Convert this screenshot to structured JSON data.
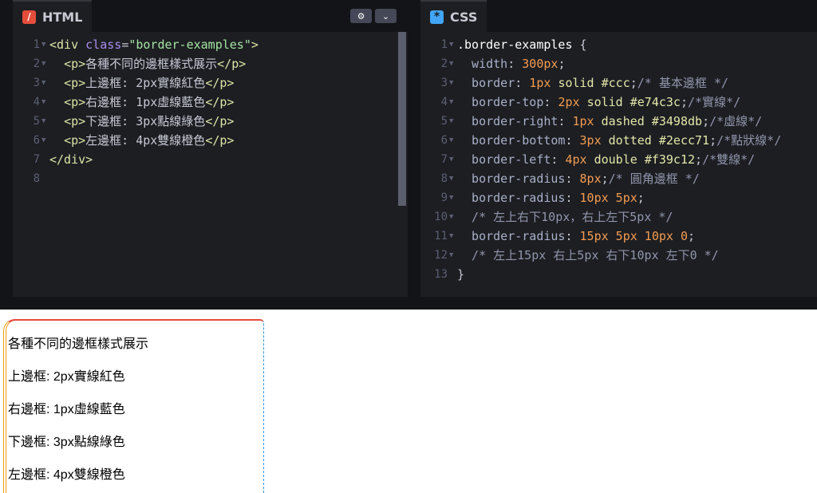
{
  "html_panel": {
    "tab_label": "HTML",
    "tab_icon": "html-logo-icon",
    "buttons": [
      "gear-icon",
      "chevron-down-icon"
    ],
    "lines": [
      {
        "n": "1",
        "fold": true,
        "tokens": [
          [
            "t-tag",
            "<div "
          ],
          [
            "t-attr",
            "class"
          ],
          [
            "t-punc",
            "="
          ],
          [
            "t-str",
            "\"border-examples\""
          ],
          [
            "t-tag",
            ">"
          ]
        ]
      },
      {
        "n": "2",
        "fold": true,
        "tokens": [
          [
            "t-punc",
            "  "
          ],
          [
            "t-tag",
            "<p>"
          ],
          [
            "t-punc",
            "各種不同的邊框樣式展示"
          ],
          [
            "t-tag",
            "</p>"
          ]
        ]
      },
      {
        "n": "3",
        "fold": true,
        "tokens": [
          [
            "t-punc",
            "  "
          ],
          [
            "t-tag",
            "<p>"
          ],
          [
            "t-punc",
            "上邊框: 2px實線紅色"
          ],
          [
            "t-tag",
            "</p>"
          ]
        ]
      },
      {
        "n": "4",
        "fold": true,
        "tokens": [
          [
            "t-punc",
            "  "
          ],
          [
            "t-tag",
            "<p>"
          ],
          [
            "t-punc",
            "右邊框: 1px虛線藍色"
          ],
          [
            "t-tag",
            "</p>"
          ]
        ]
      },
      {
        "n": "5",
        "fold": true,
        "tokens": [
          [
            "t-punc",
            "  "
          ],
          [
            "t-tag",
            "<p>"
          ],
          [
            "t-punc",
            "下邊框: 3px點線綠色"
          ],
          [
            "t-tag",
            "</p>"
          ]
        ]
      },
      {
        "n": "6",
        "fold": true,
        "tokens": [
          [
            "t-punc",
            "  "
          ],
          [
            "t-tag",
            "<p>"
          ],
          [
            "t-punc",
            "左邊框: 4px雙線橙色"
          ],
          [
            "t-tag",
            "</p>"
          ]
        ]
      },
      {
        "n": "7",
        "fold": false,
        "tokens": [
          [
            "t-tag",
            "</div>"
          ]
        ]
      },
      {
        "n": "8",
        "fold": false,
        "tokens": []
      }
    ]
  },
  "css_panel": {
    "tab_label": "CSS",
    "tab_icon": "css-asterisk-icon",
    "lines": [
      {
        "n": "1",
        "fold": true,
        "tokens": [
          [
            "t-sel",
            ".border-examples "
          ],
          [
            "t-punc",
            "{"
          ]
        ]
      },
      {
        "n": "2",
        "fold": true,
        "tokens": [
          [
            "t-prop",
            "  width"
          ],
          [
            "t-punc",
            ": "
          ],
          [
            "t-num",
            "300px"
          ],
          [
            "t-punc",
            ";"
          ]
        ]
      },
      {
        "n": "3",
        "fold": true,
        "tokens": [
          [
            "t-prop",
            "  border"
          ],
          [
            "t-punc",
            ": "
          ],
          [
            "t-num",
            "1px "
          ],
          [
            "t-kw",
            "solid "
          ],
          [
            "t-kw",
            "#ccc"
          ],
          [
            "t-punc",
            ";"
          ],
          [
            "t-cmt",
            "/* 基本邊框 */"
          ]
        ]
      },
      {
        "n": "4",
        "fold": true,
        "tokens": [
          [
            "t-prop",
            "  border-top"
          ],
          [
            "t-punc",
            ": "
          ],
          [
            "t-num",
            "2px "
          ],
          [
            "t-kw",
            "solid "
          ],
          [
            "t-kw",
            "#e74c3c"
          ],
          [
            "t-punc",
            ";"
          ],
          [
            "t-cmt",
            "/*實線*/"
          ]
        ]
      },
      {
        "n": "5",
        "fold": true,
        "tokens": [
          [
            "t-prop",
            "  border-right"
          ],
          [
            "t-punc",
            ": "
          ],
          [
            "t-num",
            "1px "
          ],
          [
            "t-kw",
            "dashed "
          ],
          [
            "t-kw",
            "#3498db"
          ],
          [
            "t-punc",
            ";"
          ],
          [
            "t-cmt",
            "/*虛線*/"
          ]
        ]
      },
      {
        "n": "6",
        "fold": true,
        "tokens": [
          [
            "t-prop",
            "  border-bottom"
          ],
          [
            "t-punc",
            ": "
          ],
          [
            "t-num",
            "3px "
          ],
          [
            "t-kw",
            "dotted "
          ],
          [
            "t-kw",
            "#2ecc71"
          ],
          [
            "t-punc",
            ";"
          ],
          [
            "t-cmt",
            "/*點狀線*/"
          ]
        ]
      },
      {
        "n": "7",
        "fold": true,
        "tokens": [
          [
            "t-prop",
            "  border-left"
          ],
          [
            "t-punc",
            ": "
          ],
          [
            "t-num",
            "4px "
          ],
          [
            "t-kw",
            "double "
          ],
          [
            "t-kw",
            "#f39c12"
          ],
          [
            "t-punc",
            ";"
          ],
          [
            "t-cmt",
            "/*雙線*/"
          ]
        ]
      },
      {
        "n": "8",
        "fold": true,
        "tokens": [
          [
            "t-prop",
            "  border-radius"
          ],
          [
            "t-punc",
            ": "
          ],
          [
            "t-num",
            "8px"
          ],
          [
            "t-punc",
            ";"
          ],
          [
            "t-cmt",
            "/* 圓角邊框 */"
          ]
        ]
      },
      {
        "n": "9",
        "fold": true,
        "tokens": [
          [
            "t-prop",
            "  border-radius"
          ],
          [
            "t-punc",
            ": "
          ],
          [
            "t-num",
            "10px 5px"
          ],
          [
            "t-punc",
            ";"
          ]
        ]
      },
      {
        "n": "10",
        "fold": true,
        "tokens": [
          [
            "t-cmt",
            "  /* 左上右下10px，右上左下5px */"
          ]
        ]
      },
      {
        "n": "11",
        "fold": true,
        "tokens": [
          [
            "t-prop",
            "  border-radius"
          ],
          [
            "t-punc",
            ": "
          ],
          [
            "t-num",
            "15px 5px 10px 0"
          ],
          [
            "t-punc",
            ";"
          ]
        ]
      },
      {
        "n": "12",
        "fold": true,
        "tokens": [
          [
            "t-cmt",
            "  /* 左上15px 右上5px 右下10px 左下0 */"
          ]
        ]
      },
      {
        "n": "13",
        "fold": false,
        "tokens": [
          [
            "t-punc",
            "}"
          ]
        ]
      }
    ]
  },
  "preview": {
    "paragraphs": [
      "各種不同的邊框樣式展示",
      "上邊框: 2px實線紅色",
      "右邊框: 1px虛線藍色",
      "下邊框: 3px點線綠色",
      "左邊框: 4px雙線橙色"
    ],
    "colors": {
      "top": "#e74c3c",
      "right": "#3498db",
      "bottom": "#2ecc71",
      "left": "#f39c12"
    }
  }
}
